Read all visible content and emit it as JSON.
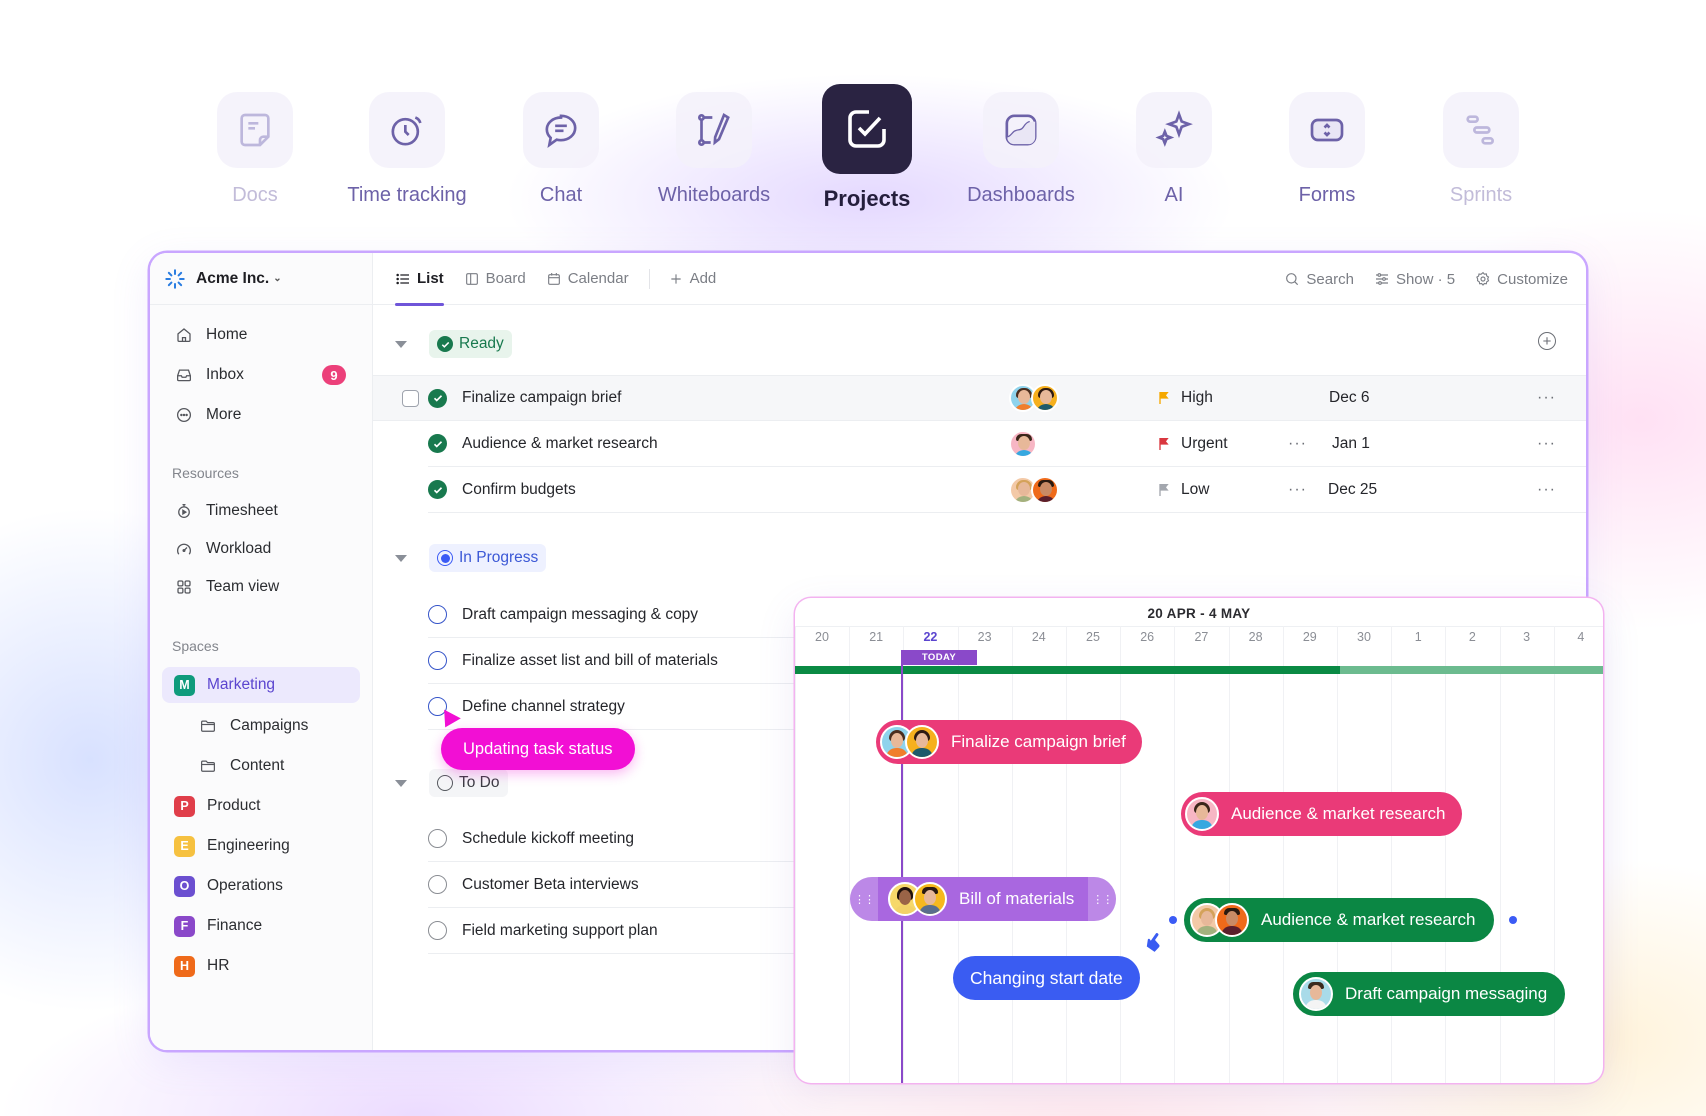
{
  "product_nav": {
    "items": [
      {
        "label": "Docs",
        "icon": "doc-icon",
        "state": "faded"
      },
      {
        "label": "Time tracking",
        "icon": "stopwatch-icon",
        "state": "normal"
      },
      {
        "label": "Chat",
        "icon": "chat-bubble-icon",
        "state": "normal"
      },
      {
        "label": "Whiteboards",
        "icon": "whiteboard-pen-icon",
        "state": "normal"
      },
      {
        "label": "Projects",
        "icon": "checkbox-icon",
        "state": "active"
      },
      {
        "label": "Dashboards",
        "icon": "chart-line-icon",
        "state": "normal"
      },
      {
        "label": "AI",
        "icon": "sparkles-icon",
        "state": "normal"
      },
      {
        "label": "Forms",
        "icon": "form-select-icon",
        "state": "normal"
      },
      {
        "label": "Sprints",
        "icon": "sprints-icon",
        "state": "faded"
      }
    ]
  },
  "workspace": {
    "name": "Acme Inc."
  },
  "sidebar": {
    "nav": [
      {
        "label": "Home",
        "icon": "home-icon"
      },
      {
        "label": "Inbox",
        "icon": "inbox-icon",
        "badge": "9"
      },
      {
        "label": "More",
        "icon": "more-circle-icon"
      }
    ],
    "resources_heading": "Resources",
    "resources": [
      {
        "label": "Timesheet",
        "icon": "timer-icon"
      },
      {
        "label": "Workload",
        "icon": "gauge-icon"
      },
      {
        "label": "Team view",
        "icon": "grid-icon"
      }
    ],
    "spaces_heading": "Spaces",
    "spaces": [
      {
        "label": "Marketing",
        "initial": "M",
        "color": "#0f9b7c",
        "active": true
      },
      {
        "label": "Campaigns",
        "folder": true
      },
      {
        "label": "Content",
        "folder": true
      },
      {
        "label": "Product",
        "initial": "P",
        "color": "#e03e4a"
      },
      {
        "label": "Engineering",
        "initial": "E",
        "color": "#f6c140"
      },
      {
        "label": "Operations",
        "initial": "O",
        "color": "#6b4fd0"
      },
      {
        "label": "Finance",
        "initial": "F",
        "color": "#8a48c9"
      },
      {
        "label": "HR",
        "initial": "H",
        "color": "#ef6a1a"
      }
    ]
  },
  "viewbar": {
    "tabs": [
      {
        "label": "List",
        "active": true
      },
      {
        "label": "Board"
      },
      {
        "label": "Calendar"
      }
    ],
    "add_label": "Add",
    "search_label": "Search",
    "show_label": "Show · 5",
    "customize_label": "Customize"
  },
  "groups": {
    "ready": {
      "label": "Ready",
      "tasks": [
        {
          "title": "Finalize campaign brief",
          "priority": "High",
          "priority_color": "#f5a800",
          "due": "Dec 6",
          "assignees": 2
        },
        {
          "title": "Audience & market research",
          "priority": "Urgent",
          "priority_color": "#d9373f",
          "due": "Jan 1",
          "assignees": 1
        },
        {
          "title": "Confirm budgets",
          "priority": "Low",
          "priority_color": "#a3a7ae",
          "due": "Dec 25",
          "assignees": 2
        }
      ]
    },
    "in_progress": {
      "label": "In Progress",
      "tasks": [
        {
          "title": "Draft campaign messaging & copy"
        },
        {
          "title": "Finalize asset list and bill of materials"
        },
        {
          "title": "Define channel strategy"
        }
      ]
    },
    "todo": {
      "label": "To Do",
      "tasks": [
        {
          "title": "Schedule kickoff meeting"
        },
        {
          "title": "Customer Beta interviews"
        },
        {
          "title": "Field marketing support plan"
        }
      ]
    }
  },
  "tooltip_status": "Updating task status",
  "gantt": {
    "range_label": "20 APR - 4 MAY",
    "days": [
      "20",
      "21",
      "22",
      "23",
      "24",
      "25",
      "26",
      "27",
      "28",
      "29",
      "30",
      "1",
      "2",
      "3",
      "4"
    ],
    "today_index": 2,
    "today_label": "TODAY",
    "progress_fraction": 0.675,
    "bars": [
      {
        "label": "Finalize campaign brief",
        "color": "pink",
        "assignees": 2
      },
      {
        "label": "Audience & market research",
        "color": "pink",
        "assignees": 1
      },
      {
        "label": "Bill of materials",
        "color": "purple",
        "assignees": 2
      },
      {
        "label": "Audience & market research",
        "color": "green",
        "assignees": 2
      },
      {
        "label": "Draft campaign messaging",
        "color": "green",
        "assignees": 1
      }
    ],
    "tooltip": "Changing start date"
  }
}
